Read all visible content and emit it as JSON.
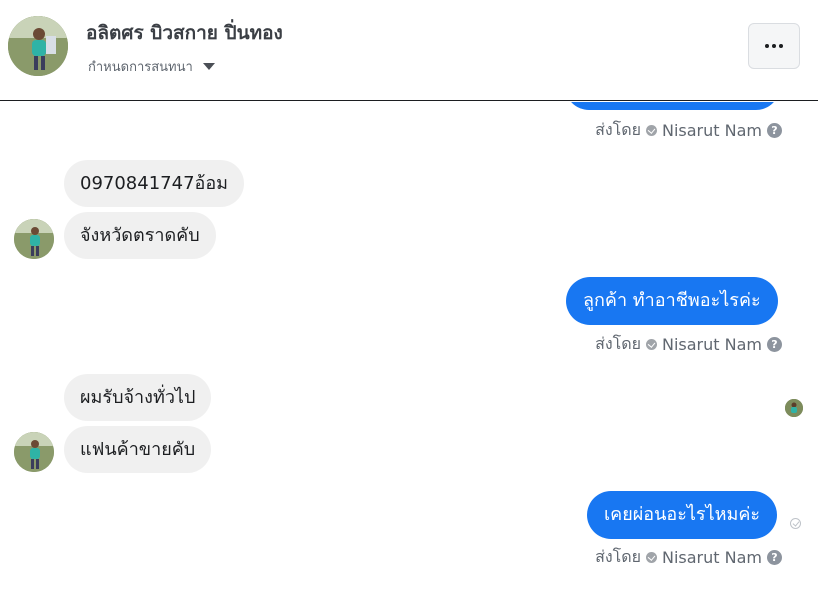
{
  "header": {
    "name": "อลิตศร บิวสกาย ปิ่นทอง",
    "subtitle": "กำหนดการสนทนา",
    "more_label": "···"
  },
  "messages": {
    "m0_sentby_prefix": "ส่งโดย",
    "m0_sentby_name": "Nisarut Nam",
    "in1": "0970841747อ้อม",
    "in2": "จังหวัดตราดคับ",
    "out1": "ลูกค้า ทำอาชีพอะไรค่ะ",
    "out1_sentby_prefix": "ส่งโดย",
    "out1_sentby_name": "Nisarut Nam",
    "in3": "ผมรับจ้างทั่วไป",
    "in4": "แฟนค้าขายคับ",
    "out2": "เคยผ่อนอะไรไหมค่ะ",
    "out2_sentby_prefix": "ส่งโดย",
    "out2_sentby_name": "Nisarut Nam",
    "help_glyph": "?"
  },
  "colors": {
    "outgoing": "#1877f2",
    "incoming": "#f0f0f0"
  }
}
